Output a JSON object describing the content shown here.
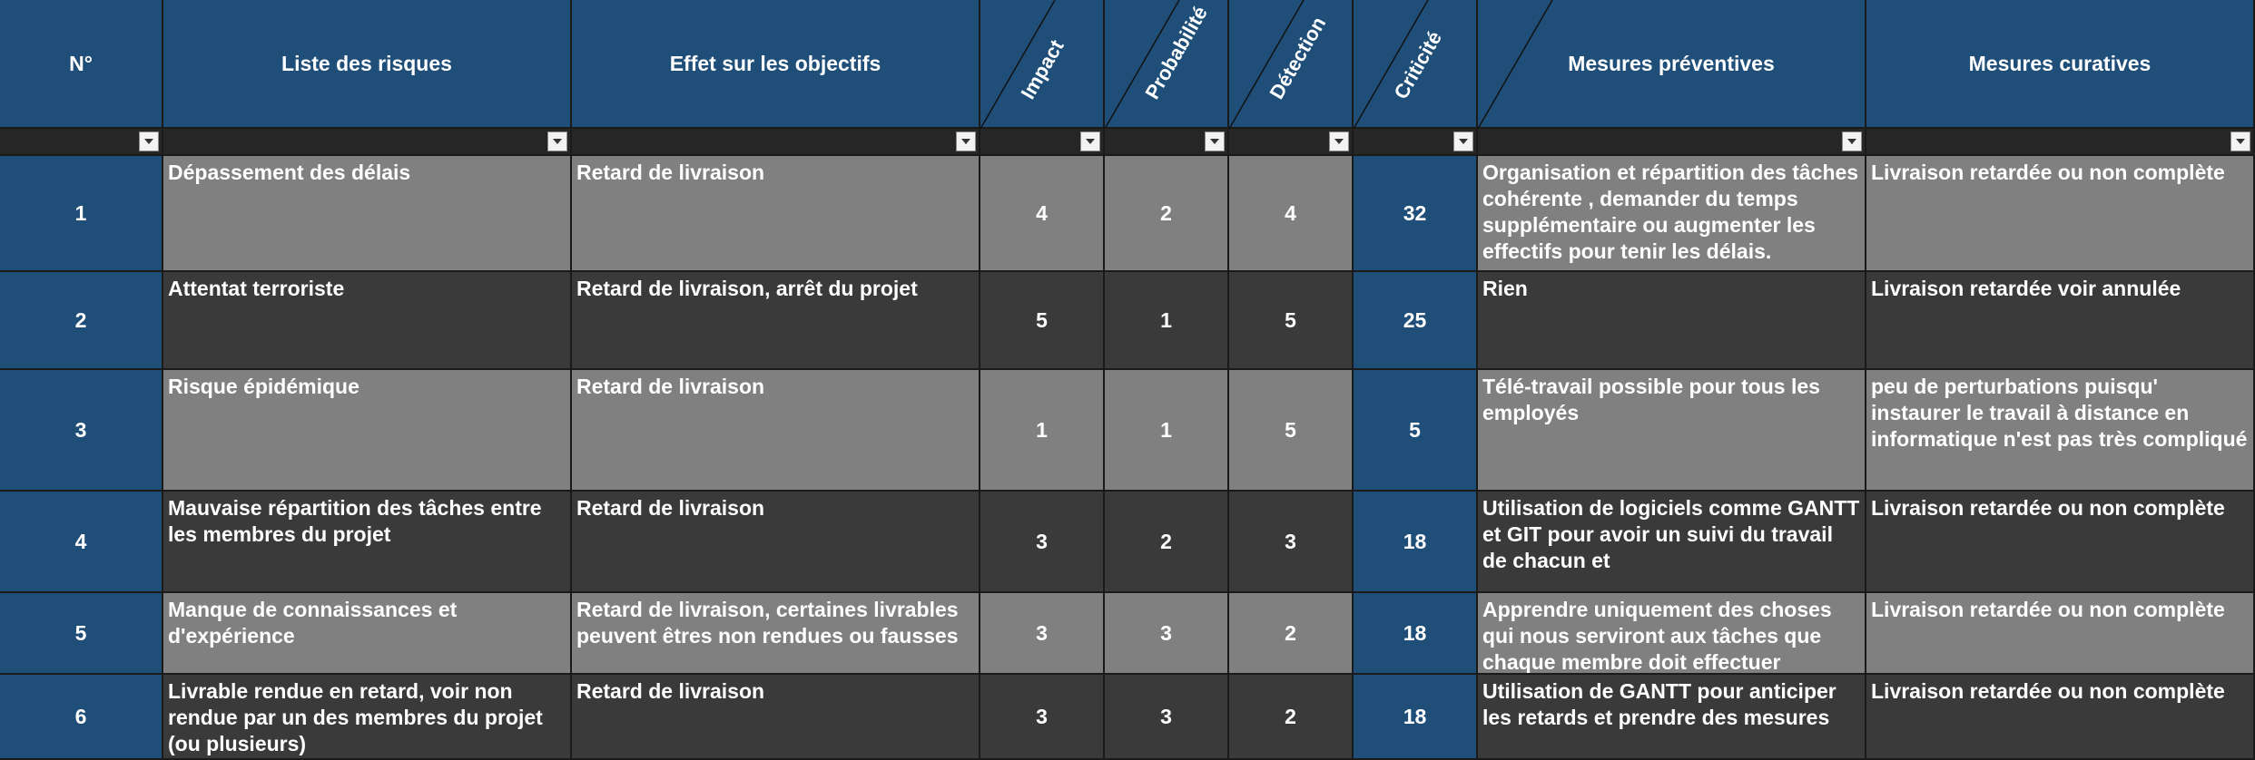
{
  "headers": {
    "num": "N°",
    "risques": "Liste des risques",
    "effet": "Effet sur les objectifs",
    "impact": "Impact",
    "probabilite": "Probabilité",
    "detection": "Détection",
    "criticite": "Criticité",
    "preventives": "Mesures préventives",
    "curatives": "Mesures curatives"
  },
  "filter_icon": "dropdown-arrow",
  "colors": {
    "header": "#1f4e79",
    "row_light": "#808080",
    "row_dark": "#3a3a3a",
    "filter_row": "#262626",
    "text": "#ffffff"
  },
  "rows": [
    {
      "num": "1",
      "risque": "Dépassement des délais",
      "effet": "Retard de livraison",
      "impact": "4",
      "probabilite": "2",
      "detection": "4",
      "criticite": "32",
      "preventive": "Organisation et répartition des tâches cohérente , demander du temps supplémentaire ou augmenter les effectifs pour tenir les délais.",
      "curative": "Livraison retardée ou non complète"
    },
    {
      "num": "2",
      "risque": "Attentat terroriste",
      "effet": "Retard de livraison, arrêt du projet",
      "impact": "5",
      "probabilite": "1",
      "detection": "5",
      "criticite": "25",
      "preventive": "Rien",
      "curative": "Livraison retardée voir annulée"
    },
    {
      "num": "3",
      "risque": "Risque épidémique",
      "effet": "Retard de livraison",
      "impact": "1",
      "probabilite": "1",
      "detection": "5",
      "criticite": "5",
      "preventive": "Télé-travail possible pour tous les employés",
      "curative": "peu de perturbations puisqu' instaurer le travail à distance en informatique n'est pas très compliqué"
    },
    {
      "num": "4",
      "risque": "Mauvaise répartition des tâches entre les membres du projet",
      "effet": "Retard de livraison",
      "impact": "3",
      "probabilite": "2",
      "detection": "3",
      "criticite": "18",
      "preventive": "Utilisation de logiciels comme GANTT et GIT pour avoir un suivi du travail de chacun et",
      "curative": "Livraison retardée ou non complète"
    },
    {
      "num": "5",
      "risque": "Manque de connaissances et d'expérience",
      "effet": "Retard de livraison,  certaines livrables peuvent êtres non rendues ou fausses",
      "impact": "3",
      "probabilite": "3",
      "detection": "2",
      "criticite": "18",
      "preventive": "Apprendre uniquement des choses qui nous serviront aux tâches que chaque membre doit effectuer",
      "curative": "Livraison retardée ou non complète"
    },
    {
      "num": "6",
      "risque": "Livrable rendue en retard, voir non rendue par un des membres du projet (ou plusieurs)",
      "effet": "Retard de livraison",
      "impact": "3",
      "probabilite": "3",
      "detection": "2",
      "criticite": "18",
      "preventive": "Utilisation de GANTT pour anticiper les retards et prendre des mesures",
      "curative": "Livraison retardée ou non complète"
    }
  ]
}
